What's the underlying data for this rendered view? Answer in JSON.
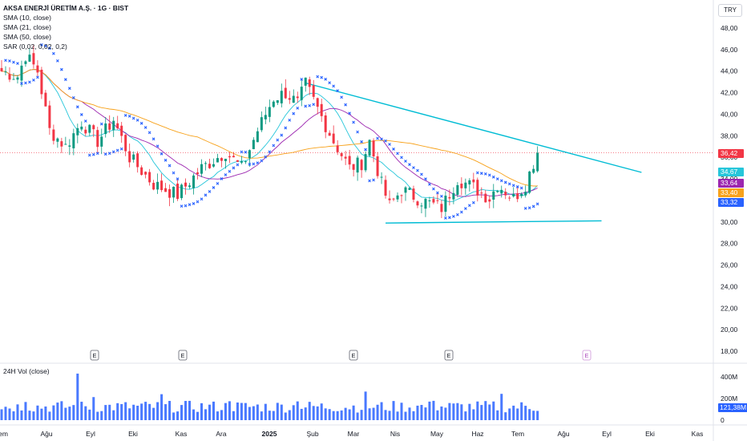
{
  "header": {
    "title": "AKSA ENERJİ ÜRETİM A.Ş. · 1G · BIST",
    "indicators": [
      "SMA (10, close)",
      "SMA (21, close)",
      "SMA (50, close)",
      "SAR (0,02, 0,02, 0,2)"
    ],
    "currency": "TRY"
  },
  "volume_panel": {
    "title": "24H Vol (close)",
    "ticks": [
      "400M",
      "200M",
      "0"
    ],
    "last_label": "121,38M"
  },
  "earnings_markers": [
    "E",
    "E",
    "E",
    "E",
    "E"
  ],
  "price_labels": [
    {
      "text": "36,42",
      "color": "#f23645"
    },
    {
      "text": "34,67",
      "color": "#26c6da"
    },
    {
      "text": "33,64",
      "color": "#9c27b0"
    },
    {
      "text": "33,40",
      "color": "#f7a21b"
    },
    {
      "text": "33,32",
      "color": "#2962ff"
    }
  ],
  "colors": {
    "up": "#089981",
    "down": "#f23645",
    "sma10": "#26c6da",
    "sma21": "#9c27b0",
    "sma50": "#f7a21b",
    "sar": "#2962ff",
    "trend": "#00bcd4",
    "volume": "#2962ff"
  },
  "chart_data": {
    "type": "candlestick",
    "title": "AKSA ENERJİ ÜRETİM A.Ş. · 1G · BIST",
    "ylim": [
      17.5,
      49
    ],
    "y_ticks": [
      "48,00",
      "46,00",
      "44,00",
      "42,00",
      "40,00",
      "38,00",
      "36,00",
      "34,00",
      "32,00",
      "30,00",
      "28,00",
      "26,00",
      "24,00",
      "22,00",
      "20,00",
      "18,00"
    ],
    "x_ticks": [
      "em",
      "Ağu",
      "Eyl",
      "Eki",
      "Kas",
      "Ara",
      "2025",
      "Şub",
      "Mar",
      "Nis",
      "May",
      "Haz",
      "Tem",
      "Ağu",
      "Eyl",
      "Eki",
      "Kas"
    ],
    "current_price": 36.42,
    "price_keypoints": [
      {
        "x": 0,
        "y": 44.0
      },
      {
        "x": 4,
        "y": 43.5
      },
      {
        "x": 6,
        "y": 45.5
      },
      {
        "x": 9,
        "y": 44.0
      },
      {
        "x": 12,
        "y": 38.5
      },
      {
        "x": 16,
        "y": 37.0
      },
      {
        "x": 20,
        "y": 39.3
      },
      {
        "x": 24,
        "y": 37.5
      },
      {
        "x": 28,
        "y": 39.5
      },
      {
        "x": 32,
        "y": 36.0
      },
      {
        "x": 38,
        "y": 33.5
      },
      {
        "x": 44,
        "y": 32.5
      },
      {
        "x": 50,
        "y": 35.0
      },
      {
        "x": 56,
        "y": 36.5
      },
      {
        "x": 60,
        "y": 35.0
      },
      {
        "x": 64,
        "y": 38.5
      },
      {
        "x": 68,
        "y": 41.5
      },
      {
        "x": 71,
        "y": 42.0
      },
      {
        "x": 74,
        "y": 41.0
      },
      {
        "x": 76,
        "y": 42.8
      },
      {
        "x": 79,
        "y": 40.5
      },
      {
        "x": 83,
        "y": 37.5
      },
      {
        "x": 87,
        "y": 35.0
      },
      {
        "x": 90,
        "y": 35.5
      },
      {
        "x": 92,
        "y": 37.5
      },
      {
        "x": 95,
        "y": 33.5
      },
      {
        "x": 97,
        "y": 31.5
      },
      {
        "x": 100,
        "y": 33.0
      },
      {
        "x": 105,
        "y": 32.0
      },
      {
        "x": 110,
        "y": 31.3
      },
      {
        "x": 114,
        "y": 34.0
      },
      {
        "x": 118,
        "y": 33.2
      },
      {
        "x": 122,
        "y": 32.2
      },
      {
        "x": 124,
        "y": 33.5
      },
      {
        "x": 128,
        "y": 32.2
      },
      {
        "x": 131,
        "y": 33.5
      },
      {
        "x": 133,
        "y": 35.5
      },
      {
        "x": 134,
        "y": 36.42
      }
    ],
    "trendlines": [
      {
        "name": "",
        "from": {
          "x": 76,
          "y": 42.9
        },
        "to": {
          "x": 160,
          "y": 34.6
        }
      },
      {
        "name": "",
        "from": {
          "x": 96,
          "y": 29.9
        },
        "to": {
          "x": 150,
          "y": 30.1
        }
      }
    ]
  }
}
